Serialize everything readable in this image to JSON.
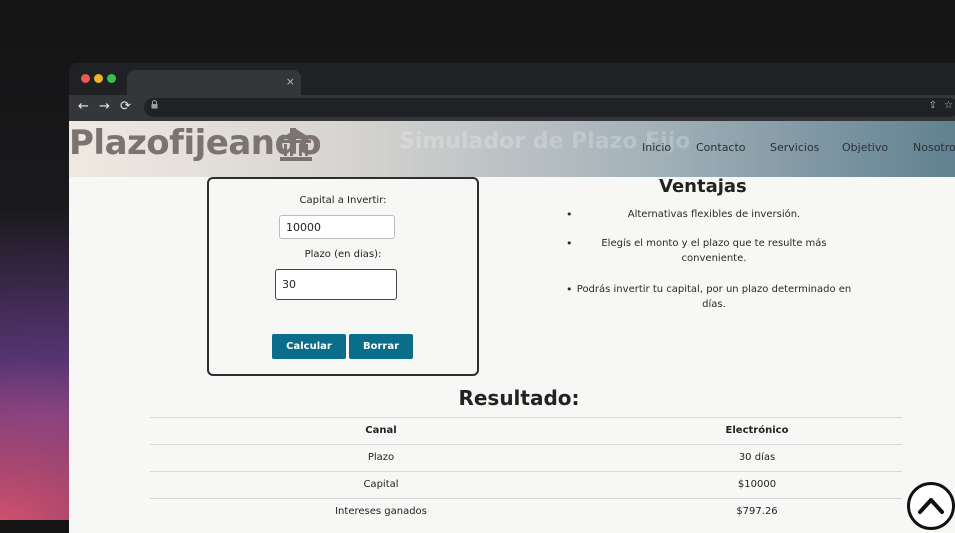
{
  "browser": {
    "tab_title": "",
    "tab_close": "×",
    "url": "",
    "back": "←",
    "forward": "→",
    "reload": "⟳",
    "lock": "🔒",
    "share": "⇪",
    "star": "☆"
  },
  "site": {
    "logo_text": "Plazofijeando",
    "logo_icon": "bank-icon",
    "ghost_title": "Simulador de Plazo Fijo",
    "nav": [
      "Inicio",
      "Contacto",
      "Servicios",
      "Objetivo",
      "Nosotros"
    ]
  },
  "form": {
    "capital_label": "Capital a Invertir:",
    "capital_value": "10000",
    "plazo_label": "Plazo (en dias):",
    "plazo_value": "30",
    "calcular_label": "Calcular",
    "borrar_label": "Borrar",
    "button_color": "#0a6e8a"
  },
  "ventajas": {
    "title": "Ventajas",
    "items": [
      "Alternativas flexibles de inversión.",
      "Elegís el monto y el plazo que te resulte más conveniente.",
      "Podrás invertir tu capital, por un plazo determinado en días."
    ]
  },
  "resultado": {
    "title": "Resultado:",
    "headers": [
      "Canal",
      "Electrónico"
    ],
    "rows": [
      [
        "Plazo",
        "30 días"
      ],
      [
        "Capital",
        "$10000"
      ],
      [
        "Intereses ganados",
        "$797.26"
      ]
    ]
  },
  "scroll_top_icon": "chevron-up-icon"
}
